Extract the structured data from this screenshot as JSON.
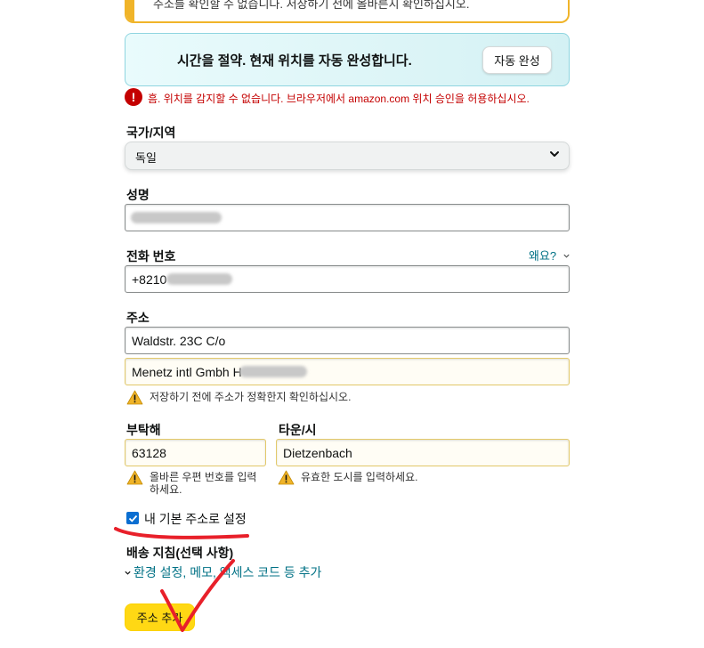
{
  "top_alert": {
    "text": "주소를 확인할 수 없습니다. 저장하기 전에 올바른지 확인하십시오."
  },
  "autofill": {
    "message": "시간을 절약. 현재 위치를 자동 완성합니다.",
    "button_label": "자동 완성"
  },
  "location_error": "흠. 위치를 감지할 수 없습니다. 브라우저에서 amazon.com 위치 승인을 허용하십시오.",
  "country": {
    "label": "국가/지역",
    "value": "독일"
  },
  "full_name": {
    "label": "성명",
    "value": ""
  },
  "phone": {
    "label": "전화 번호",
    "value": "+8210",
    "why_link": "왜요?"
  },
  "address": {
    "label": "주소",
    "line1": "Waldstr. 23C C/o",
    "line2": "Menetz intl Gmbh H",
    "warning": "저장하기 전에 주소가 정확한지 확인하십시오."
  },
  "postal": {
    "label": "부탁해",
    "value": "63128",
    "warning_line1": "올바른 우편 번호를 입력",
    "warning_line2": "하세요."
  },
  "city": {
    "label": "타운/시",
    "value": "Dietzenbach",
    "warning": "유효한 도시를 입력하세요."
  },
  "default_address": {
    "label": "내 기본 주소로 설정",
    "checked": true
  },
  "delivery": {
    "label": "배송 지침(선택 사항)",
    "link": "환경 설정, 메모, 액세스 코드 등 추가"
  },
  "submit_label": "주소 추가",
  "colors": {
    "accent": "#ffd814",
    "link": "#007185",
    "error": "#c40000",
    "warning": "#f0b429",
    "annotation": "#e8202a"
  }
}
